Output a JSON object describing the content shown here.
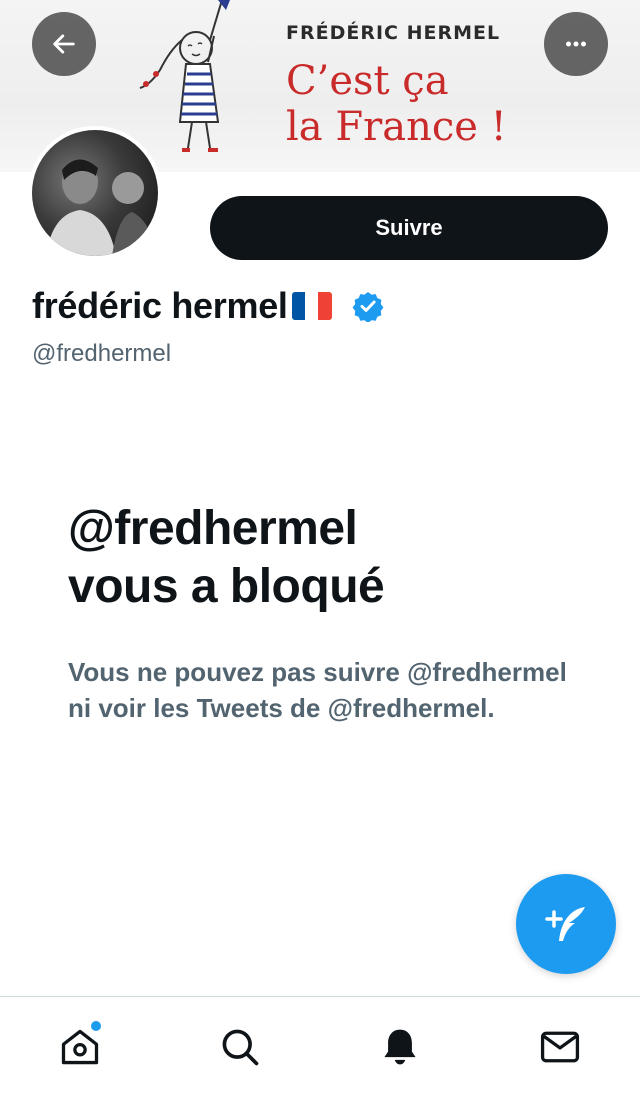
{
  "banner": {
    "author": "FRÉDÉRIC HERMEL",
    "title_line1": "C’est ça",
    "title_line2": "la France !"
  },
  "header": {
    "back_icon": "arrow-left-icon",
    "more_icon": "more-horizontal-icon"
  },
  "profile": {
    "display_name": "frédéric hermel",
    "flag": "French flag emoji",
    "verified": true,
    "handle": "@fredhermel",
    "follow_label": "Suivre"
  },
  "blocked": {
    "title_line1": "@fredhermel",
    "title_line2": "vous a bloqué",
    "description": "Vous ne pouvez pas suivre @fredhermel ni voir les Tweets de @fredhermel."
  },
  "tabs": [
    {
      "name": "home",
      "icon": "home-icon",
      "has_notification_dot": true
    },
    {
      "name": "search",
      "icon": "search-icon"
    },
    {
      "name": "notifications",
      "icon": "bell-icon"
    },
    {
      "name": "messages",
      "icon": "mail-icon"
    }
  ],
  "colors": {
    "accent": "#1d9bf0",
    "text_primary": "#0f1419",
    "text_secondary": "#536471",
    "banner_title": "#c92a2a",
    "flag_blue": "#0055a4",
    "flag_white": "#ffffff",
    "flag_red": "#ef4135"
  }
}
